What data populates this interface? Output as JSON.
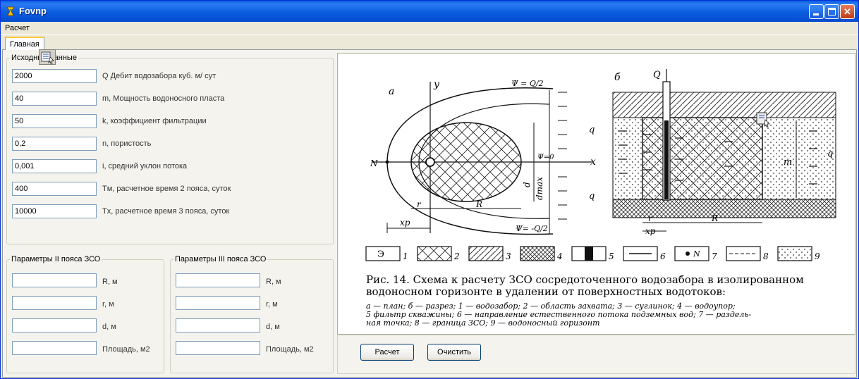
{
  "window": {
    "title": "Fovnp"
  },
  "menu": [
    "Расчет"
  ],
  "tabs": [
    "Главная"
  ],
  "source_group": {
    "title": "Исходные данные",
    "fields": [
      {
        "value": "2000",
        "label": "Q Дебит водозабора куб. м/ сут"
      },
      {
        "value": "40",
        "label": "m, Мощность водоносного пласта"
      },
      {
        "value": "50",
        "label": "k, коэффициент фильтрации"
      },
      {
        "value": "0,2",
        "label": "n, пористость"
      },
      {
        "value": "0,001",
        "label": "i, средний уклон потока"
      },
      {
        "value": "400",
        "label": "Tм, расчетное время 2 пояса, суток"
      },
      {
        "value": "10000",
        "label": "Tx, расчетное время 3 пояса, суток"
      }
    ]
  },
  "zone2": {
    "title": "Параметры II пояса ЗСО",
    "fields": [
      {
        "value": "",
        "label": "R, м"
      },
      {
        "value": "",
        "label": "r, м"
      },
      {
        "value": "",
        "label": "d, м"
      },
      {
        "value": "",
        "label": "Площадь, м2"
      }
    ]
  },
  "zone3": {
    "title": "Параметры III пояса ЗСО",
    "fields": [
      {
        "value": "",
        "label": "R, м"
      },
      {
        "value": "",
        "label": "r, м"
      },
      {
        "value": "",
        "label": "d, м"
      },
      {
        "value": "",
        "label": "Площадь, м2"
      }
    ]
  },
  "figure": {
    "label_a": "а",
    "label_b": "б",
    "label_y": "y",
    "label_x": "x",
    "label_N": "N",
    "label_Q": "Q",
    "label_q": "q",
    "label_psi_top": "Ψ = Q/2",
    "label_psi_bot": "Ψ= -Q/2",
    "label_psi0": "Ψ=0",
    "label_xp": "xp",
    "label_r": "r",
    "label_R": "R",
    "label_d": "d",
    "label_dmax": "dmax",
    "label_m": "m",
    "legend_nums": [
      "1",
      "2",
      "3",
      "4",
      "5",
      "6",
      "7",
      "8",
      "9"
    ],
    "legend_e": "Э",
    "caption_title": "Рис. 14. Схема к расчету ЗСО сосредоточенного водозабора в изолированном водоносном горизонте в удалении от поверхностных водотоков:",
    "caption_line1": "а — план; б — разрез; 1 — водозабор; 2 — область захвата; 3 — суглинок; 4 — водоупор;",
    "caption_line2": "5 фильтр скважины; 6 — направление естественного потока подземных вод; 7 — раздель-",
    "caption_line3": "ная точка; 8 — граница ЗСО; 9 — водоносный горизонт"
  },
  "buttons": {
    "calc": "Расчет",
    "clear": "Очистить"
  },
  "icons": [
    "app-icon",
    "minimize-icon",
    "maximize-icon",
    "close-icon",
    "drag-icon"
  ]
}
